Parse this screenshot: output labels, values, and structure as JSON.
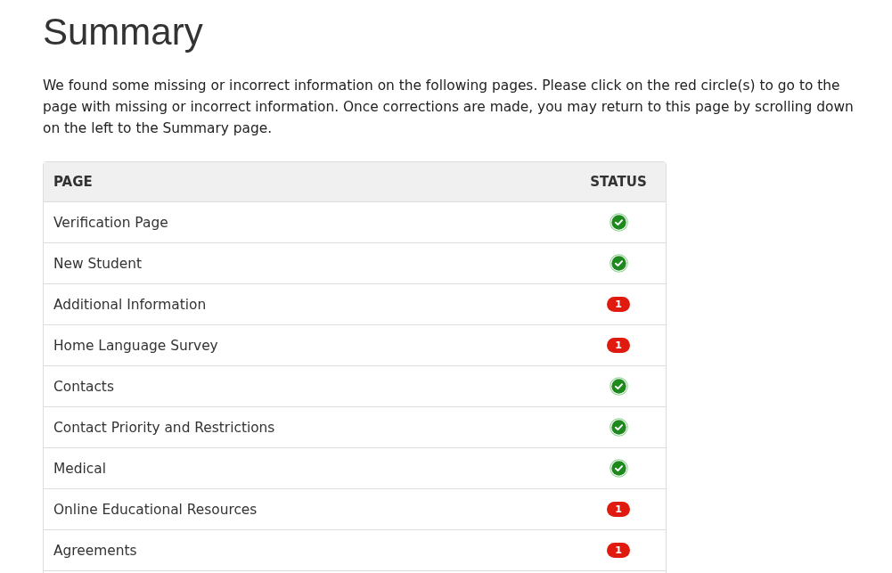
{
  "title": "Summary",
  "intro": "We found some missing or incorrect information on the following pages. Please click on the red circle(s) to go to the page with missing or incorrect information. Once corrections are made, you may return to this page by scrolling down on the left to the Summary page.",
  "table": {
    "columns": [
      "PAGE",
      "STATUS"
    ],
    "rows": [
      {
        "page": "Verification Page",
        "status": {
          "kind": "complete"
        }
      },
      {
        "page": "New Student",
        "status": {
          "kind": "complete"
        }
      },
      {
        "page": "Additional Information",
        "status": {
          "kind": "errors",
          "count": "1"
        }
      },
      {
        "page": "Home Language Survey",
        "status": {
          "kind": "errors",
          "count": "1"
        }
      },
      {
        "page": "Contacts",
        "status": {
          "kind": "complete"
        }
      },
      {
        "page": "Contact Priority and Restrictions",
        "status": {
          "kind": "complete"
        }
      },
      {
        "page": "Medical",
        "status": {
          "kind": "complete"
        }
      },
      {
        "page": "Online Educational Resources",
        "status": {
          "kind": "errors",
          "count": "1"
        }
      },
      {
        "page": "Agreements",
        "status": {
          "kind": "errors",
          "count": "1"
        }
      }
    ]
  }
}
